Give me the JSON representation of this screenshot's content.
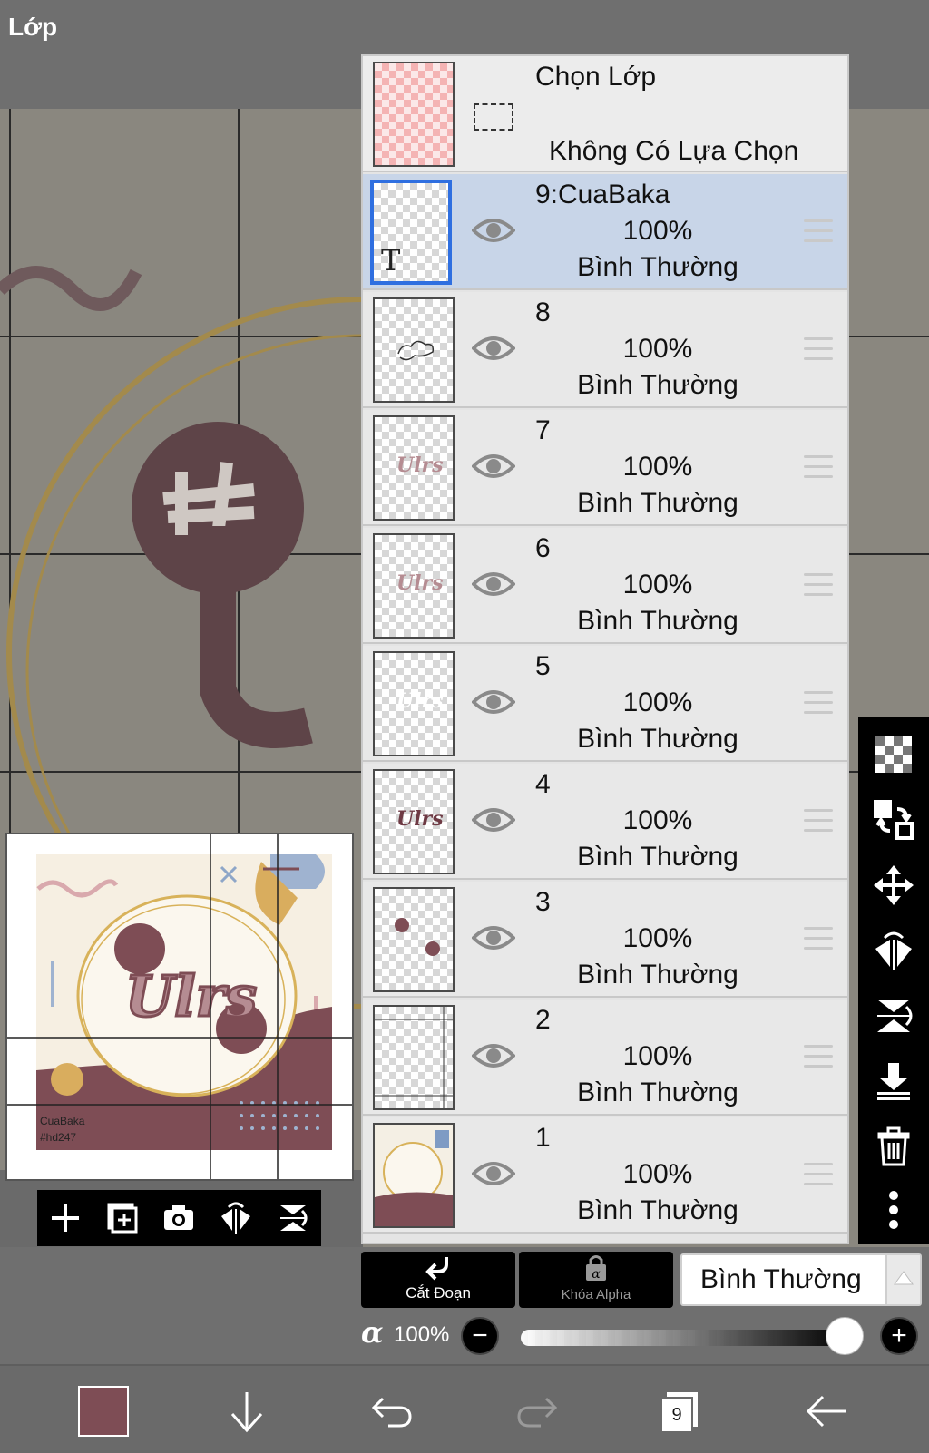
{
  "title": "Lớp",
  "selection_layer": {
    "title": "Chọn Lớp",
    "status": "Không Có Lựa Chọn"
  },
  "layers": [
    {
      "name": "9:CuaBaka",
      "opacity": "100%",
      "mode": "Bình Thường",
      "selected": true
    },
    {
      "name": "8",
      "opacity": "100%",
      "mode": "Bình Thường",
      "selected": false
    },
    {
      "name": "7",
      "opacity": "100%",
      "mode": "Bình Thường",
      "selected": false
    },
    {
      "name": "6",
      "opacity": "100%",
      "mode": "Bình Thường",
      "selected": false
    },
    {
      "name": "5",
      "opacity": "100%",
      "mode": "Bình Thường",
      "selected": false
    },
    {
      "name": "4",
      "opacity": "100%",
      "mode": "Bình Thường",
      "selected": false
    },
    {
      "name": "3",
      "opacity": "100%",
      "mode": "Bình Thường",
      "selected": false
    },
    {
      "name": "2",
      "opacity": "100%",
      "mode": "Bình Thường",
      "selected": false
    },
    {
      "name": "1",
      "opacity": "100%",
      "mode": "Bình Thường",
      "selected": false
    }
  ],
  "thumb_text": {
    "text_layer_marker": "T",
    "sample": "Ulrs"
  },
  "preview": {
    "credit_name": "CuaBaka",
    "credit_tag": "#hd247",
    "logo_text": "Ulrs"
  },
  "actions": {
    "clipping_label": "Cắt Đoạn",
    "alpha_lock_label": "Khóa Alpha",
    "blend_mode": "Bình Thường"
  },
  "alpha": {
    "symbol": "α",
    "value": "100%",
    "minus": "−",
    "plus": "+",
    "fraction": 1.0
  },
  "bottom_bar": {
    "color": "#7e4d55",
    "layer_count": "9"
  },
  "icons": {
    "right_toolbar": [
      "transparency-checker-icon",
      "layer-transfer-icon",
      "move-icon",
      "flip-horizontal-icon",
      "flip-vertical-icon",
      "merge-down-icon",
      "trash-icon",
      "more-icon"
    ],
    "preview_toolbar": [
      "add-layer-icon",
      "add-image-layer-icon",
      "camera-icon",
      "flip-horizontal-icon",
      "flip-vertical-icon"
    ]
  }
}
